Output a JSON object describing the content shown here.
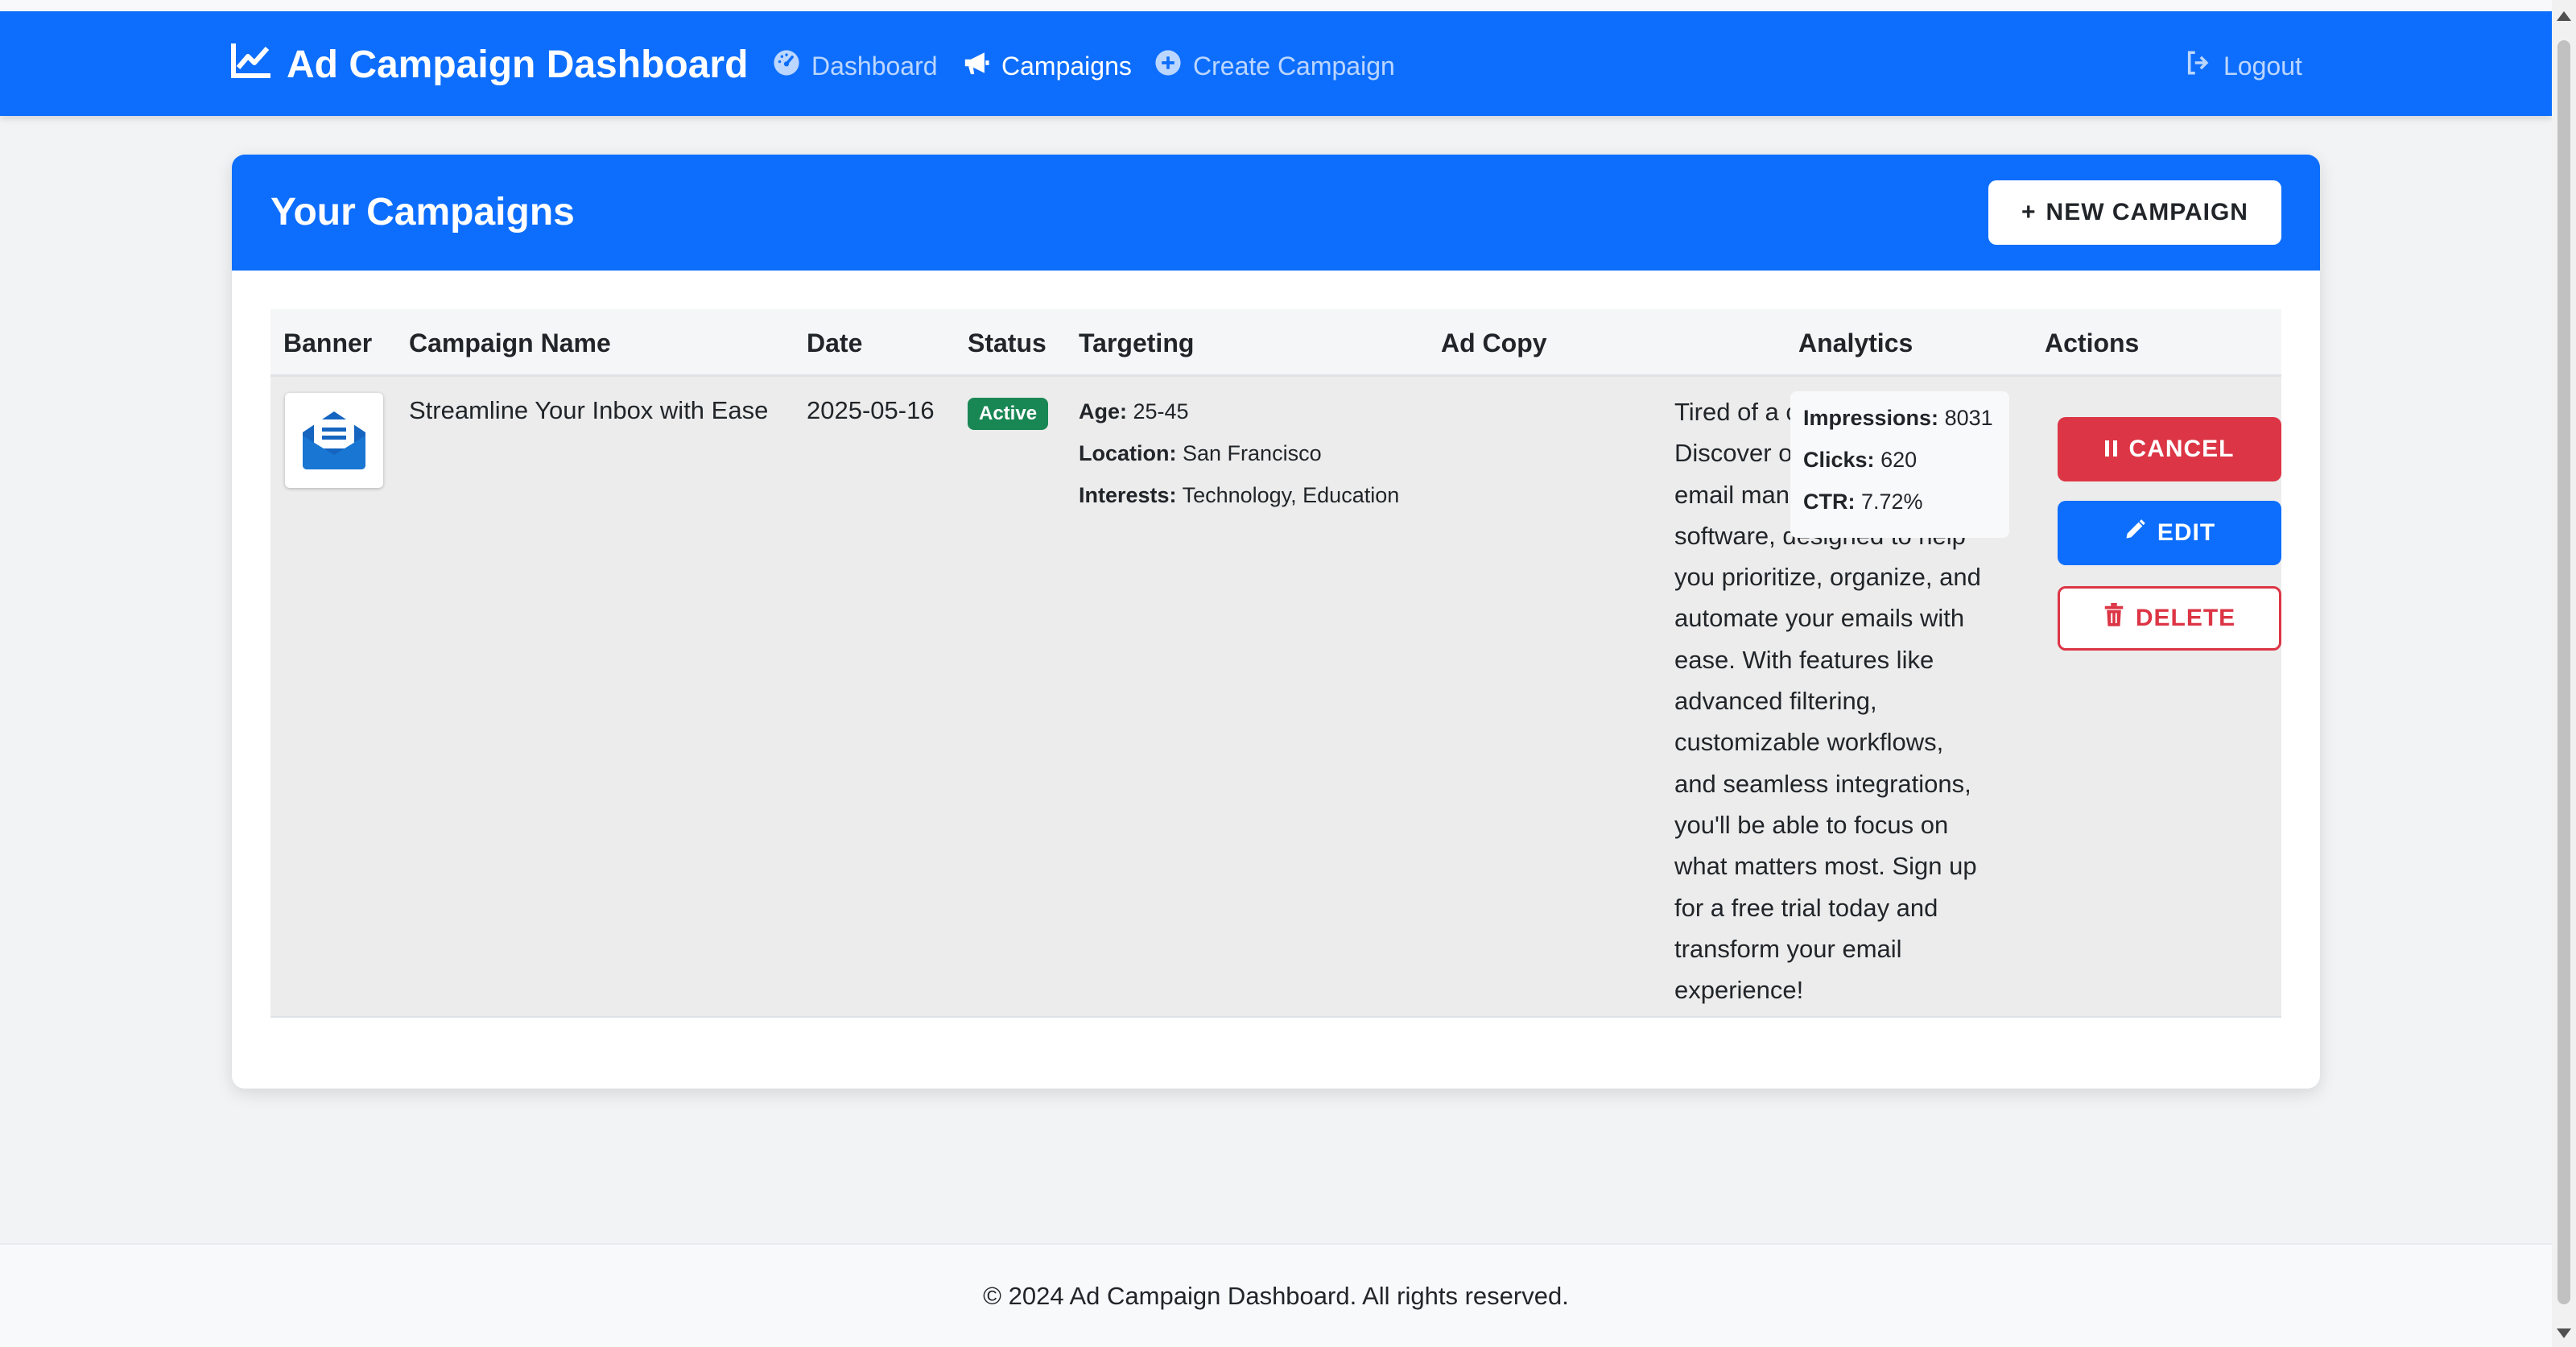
{
  "nav": {
    "brand": "Ad Campaign Dashboard",
    "items": [
      {
        "label": "Dashboard",
        "icon": "tachometer-icon"
      },
      {
        "label": "Campaigns",
        "icon": "bullhorn-icon"
      },
      {
        "label": "Create Campaign",
        "icon": "plus-circle-icon"
      }
    ],
    "logout": "Logout"
  },
  "card": {
    "title": "Your Campaigns",
    "new_button": "NEW CAMPAIGN"
  },
  "table": {
    "headers": [
      "Banner",
      "Campaign Name",
      "Date",
      "Status",
      "Targeting",
      "Ad Copy",
      "Analytics",
      "Actions"
    ],
    "rows": [
      {
        "banner_icon": "envelope-open-icon",
        "name": "Streamline Your Inbox with Ease",
        "date": "2025-05-16",
        "status": "Active",
        "targeting": {
          "age_label": "Age:",
          "age": "25-45",
          "location_label": "Location:",
          "location": "San Francisco",
          "interests_label": "Interests:",
          "interests": "Technology, Education"
        },
        "ad_copy_lines": [
          "Tired of a cluttered inbox?",
          "Discover our cutting-edge",
          "email management",
          "software, designed to help",
          "you prioritize, organize, and",
          "automate your emails with",
          "ease. With features like",
          "advanced filtering,",
          "customizable workflows,",
          "and seamless integrations,",
          "you'll be able to focus on",
          "what matters most. Sign up",
          "for a free trial today and",
          "transform your email",
          "experience!"
        ],
        "analytics": {
          "impressions_label": "Impressions:",
          "impressions": "8031",
          "clicks_label": "Clicks:",
          "clicks": "620",
          "ctr_label": "CTR:",
          "ctr": "7.72%"
        },
        "actions": {
          "cancel": "CANCEL",
          "edit": "EDIT",
          "delete": "DELETE"
        }
      }
    ]
  },
  "footer": "© 2024 Ad Campaign Dashboard. All rights reserved.",
  "colors": {
    "primary": "#0d6efd",
    "danger": "#dc3545",
    "success": "#198754"
  }
}
